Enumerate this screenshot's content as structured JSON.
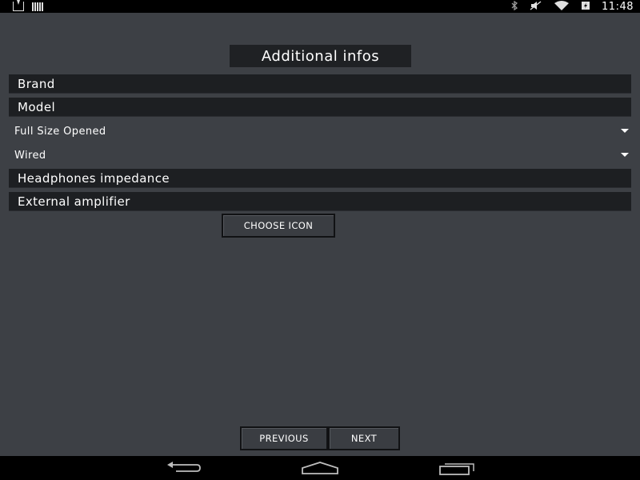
{
  "status_bar": {
    "time": "11:48",
    "icons": [
      "download-icon",
      "signal-bars-icon",
      "bluetooth-icon",
      "muted-icon",
      "wifi-icon",
      "battery-charging-icon"
    ]
  },
  "screen": {
    "title": "Additional infos",
    "fields": {
      "brand_placeholder": "Brand",
      "model_placeholder": "Model",
      "impedance_placeholder": "Headphones impedance",
      "amplifier_placeholder": "External amplifier"
    },
    "spinners": {
      "size_value": "Full Size Opened",
      "connection_value": "Wired"
    },
    "buttons": {
      "choose_icon": "CHOOSE ICON",
      "previous": "PREVIOUS",
      "next": "NEXT"
    }
  },
  "nav_bar": {
    "icons": [
      "back-icon",
      "home-icon",
      "recents-icon"
    ]
  },
  "colors": {
    "background": "#3d4045",
    "field_background": "#1d1f22",
    "bar_background": "#000000",
    "text": "#ffffff"
  }
}
